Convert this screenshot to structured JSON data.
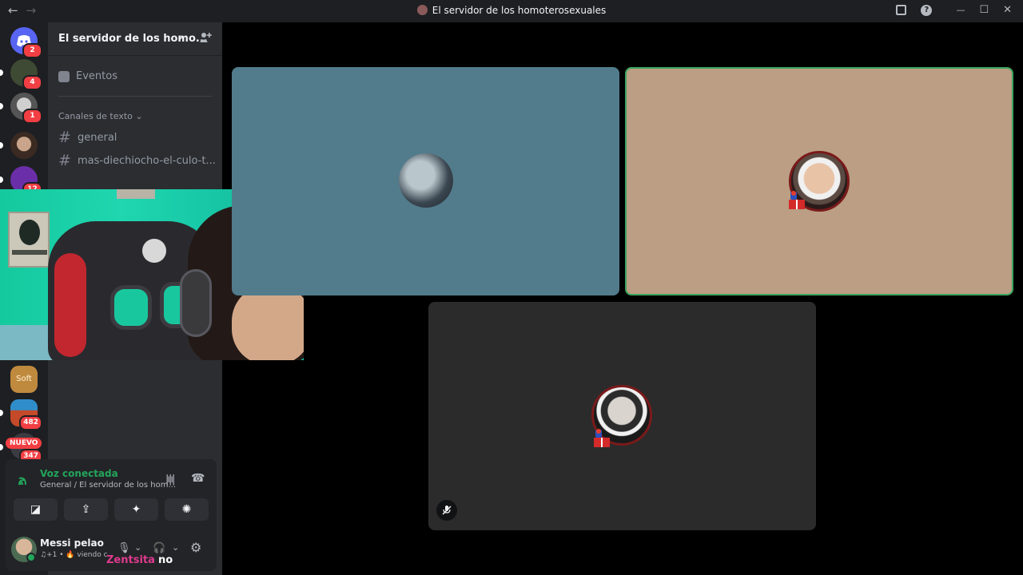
{
  "window": {
    "title": "El servidor de los homoterosexuales",
    "back_icon": "arrow-left-icon",
    "forward_icon": "arrow-right-icon",
    "back": "←",
    "forward": "→",
    "minimize": "—",
    "maximize": "☐",
    "close": "✕",
    "help": "?"
  },
  "guilds": [
    {
      "name": "home",
      "icon": "discord-logo-icon",
      "badge": "2",
      "color": "#5865f2"
    },
    {
      "name": "guild-2",
      "badge": "4",
      "color": "#3e4a33"
    },
    {
      "name": "guild-3",
      "badge": "1",
      "color": "#d8d8d8"
    },
    {
      "name": "guild-4",
      "badge": "",
      "color": "#8b6a5a"
    },
    {
      "name": "guild-5",
      "badge": "12",
      "color": "#6a2fa8"
    },
    {
      "name": "guild-6",
      "badge": "",
      "color": "#c08a3e",
      "label": "Soft"
    },
    {
      "name": "guild-7",
      "badge": "482",
      "color": "#c44a2a"
    },
    {
      "name": "guild-8",
      "badge": "347",
      "color": "#3a3c42"
    }
  ],
  "nuevo_label": "NUEVO",
  "server": {
    "name": "El servidor de los homo...",
    "chevron": "⌄",
    "invite_icon": "add-member-icon",
    "events_label": "Eventos",
    "category": "Canales de texto",
    "category_chevron": "⌄",
    "channels": [
      {
        "hash": "#",
        "name": "general"
      },
      {
        "hash": "#",
        "name": "mas-diechiocho-el-culo-t..."
      }
    ]
  },
  "voice": {
    "status": "Voz conectada",
    "channel": "General / El servidor de los hom...",
    "buttons": [
      {
        "name": "camera-off",
        "glyph": "◪"
      },
      {
        "name": "screen-share",
        "glyph": "⇪"
      },
      {
        "name": "activities",
        "glyph": "✦"
      },
      {
        "name": "soundboard",
        "glyph": "✺"
      }
    ]
  },
  "user": {
    "name": "Messi pelao",
    "status": "♫+1 • 🔥 viendo c",
    "mic": "🎙",
    "headset": "🎧",
    "settings": "⚙",
    "dropdown": "⌄"
  },
  "overlay_caption": {
    "left": "Zentsita",
    "right": "no",
    "left_color": "#e03a8e",
    "right_color": "#ffffff"
  },
  "tiles": [
    {
      "name": "participant-1",
      "bg": "#527c8c",
      "speaking": false
    },
    {
      "name": "participant-2",
      "bg": "#bb9e84",
      "speaking": true
    },
    {
      "name": "participant-3",
      "bg": "#2b2b2c",
      "speaking": false,
      "muted": true
    }
  ],
  "colors": {
    "accent_green": "#23a55a",
    "badge_red": "#f23f43",
    "speaking_border": "#3ba55d"
  }
}
